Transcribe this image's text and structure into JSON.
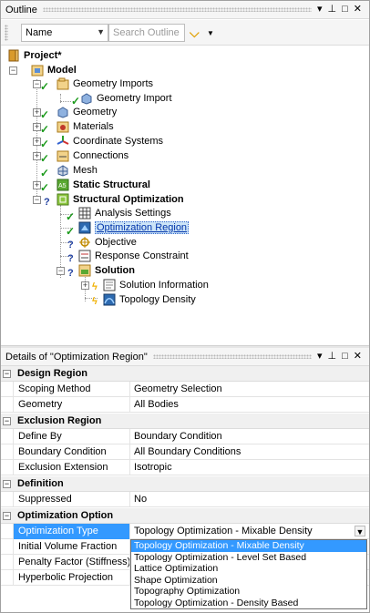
{
  "outline": {
    "title": "Outline",
    "header_buttons": {
      "dropdown": "▾",
      "pin": "⊥",
      "restore": "□",
      "close": "✕"
    },
    "toolbar": {
      "name_combo_value": "Name",
      "search_placeholder": "Search Outline"
    },
    "tree": [
      {
        "label": "Project*"
      },
      {
        "label": "Model"
      },
      {
        "label": "Geometry Imports"
      },
      {
        "label": "Geometry Import"
      },
      {
        "label": "Geometry"
      },
      {
        "label": "Materials"
      },
      {
        "label": "Coordinate Systems"
      },
      {
        "label": "Connections"
      },
      {
        "label": "Mesh"
      },
      {
        "label": "Static Structural"
      },
      {
        "label": "Structural Optimization"
      },
      {
        "label": "Analysis Settings"
      },
      {
        "label": "Optimization Region"
      },
      {
        "label": "Objective"
      },
      {
        "label": "Response Constraint"
      },
      {
        "label": "Solution"
      },
      {
        "label": "Solution Information"
      },
      {
        "label": "Topology Density"
      }
    ]
  },
  "details": {
    "title": "Details of \"Optimization Region\"",
    "groups": [
      {
        "label": "Design Region",
        "rows": [
          {
            "name": "Scoping Method",
            "value": "Geometry Selection"
          },
          {
            "name": "Geometry",
            "value": "All Bodies"
          }
        ]
      },
      {
        "label": "Exclusion Region",
        "rows": [
          {
            "name": "Define By",
            "value": "Boundary Condition"
          },
          {
            "name": "Boundary Condition",
            "value": "All Boundary Conditions"
          },
          {
            "name": "Exclusion Extension",
            "value": "Isotropic"
          }
        ]
      },
      {
        "label": "Definition",
        "rows": [
          {
            "name": "Suppressed",
            "value": "No"
          }
        ]
      },
      {
        "label": "Optimization Option",
        "rows": [
          {
            "name": "Optimization Type",
            "value": "Topology Optimization - Mixable Density"
          },
          {
            "name": "Initial Volume Fraction",
            "value": ""
          },
          {
            "name": "Penalty Factor (Stiffness)",
            "value": ""
          },
          {
            "name": "Hyperbolic Projection",
            "value": ""
          }
        ]
      }
    ],
    "optimization_type_options": [
      "Topology Optimization - Mixable Density",
      "Topology Optimization - Level Set Based",
      "Lattice Optimization",
      "Shape Optimization",
      "Topography Optimization",
      "Topology Optimization - Density Based"
    ]
  },
  "colors": {
    "selection": "#3399ff",
    "check": "#1c9a1c",
    "question": "#1e3e9e",
    "bolt": "#f0b000"
  }
}
